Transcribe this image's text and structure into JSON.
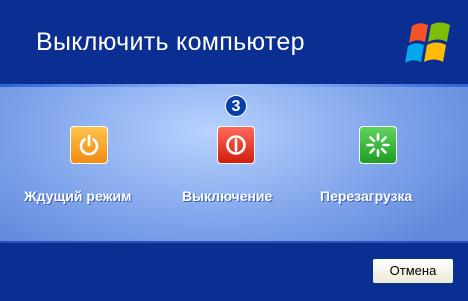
{
  "dialog": {
    "title": "Выключить компьютер",
    "step_badge": "3",
    "options": {
      "standby": {
        "label": "Ждущий режим",
        "icon": "power-standby-icon",
        "color": "#f5a623"
      },
      "turn_off": {
        "label": "Выключение",
        "icon": "power-off-icon",
        "color": "#e0301e"
      },
      "restart": {
        "label": "Перезагрузка",
        "icon": "restart-icon",
        "color": "#2fae2c"
      }
    },
    "cancel_label": "Отмена"
  },
  "colors": {
    "titlebar": "#0b2e93",
    "content": "#8db0f0",
    "footer": "#0b2e93"
  }
}
